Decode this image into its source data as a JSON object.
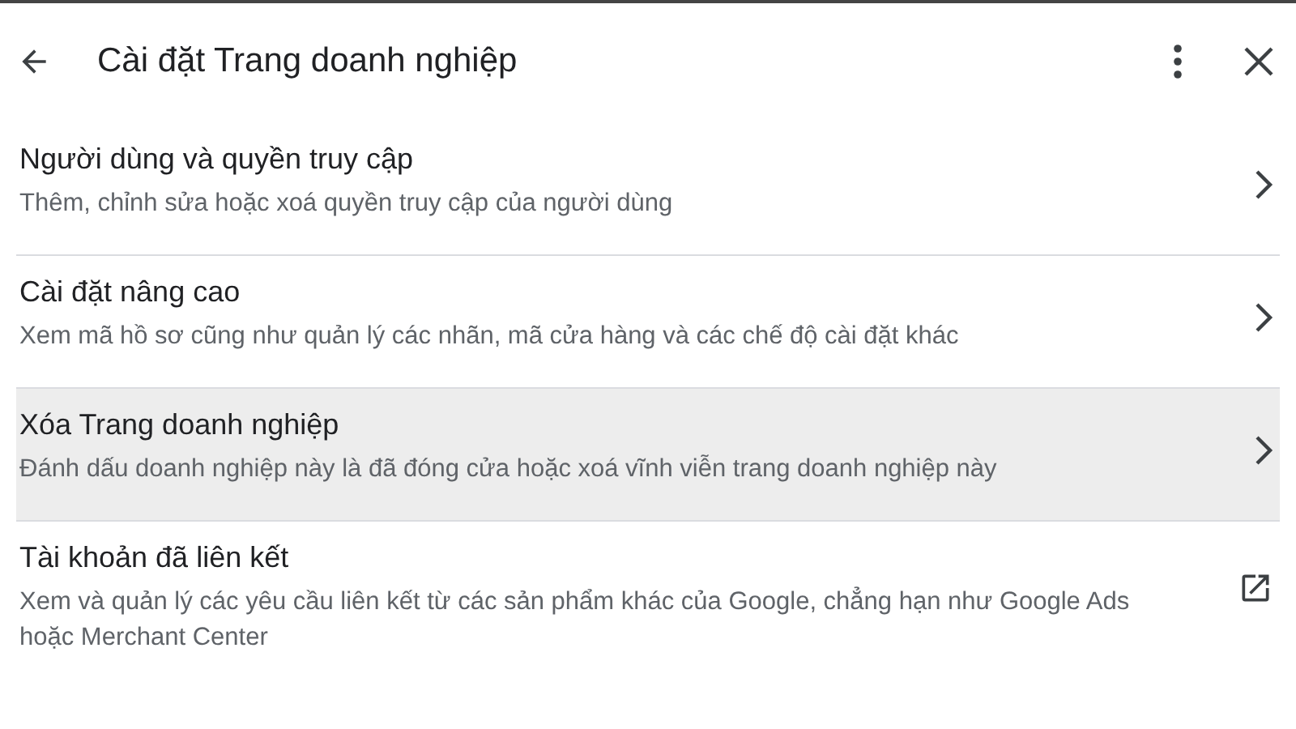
{
  "header": {
    "title": "Cài đặt Trang doanh nghiệp"
  },
  "items": [
    {
      "title": "Người dùng và quyền truy cập",
      "subtitle": "Thêm, chỉnh sửa hoặc xoá quyền truy cập của người dùng",
      "kind": "chevron",
      "selected": false
    },
    {
      "title": "Cài đặt nâng cao",
      "subtitle": "Xem mã hồ sơ cũng như quản lý các nhãn, mã cửa hàng và các chế độ cài đặt khác",
      "kind": "chevron",
      "selected": false
    },
    {
      "title": "Xóa Trang doanh nghiệp",
      "subtitle": "Đánh dấu doanh nghiệp này là đã đóng cửa hoặc xoá vĩnh viễn trang doanh nghiệp này",
      "kind": "chevron",
      "selected": true
    },
    {
      "title": "Tài khoản đã liên kết",
      "subtitle": "Xem và quản lý các yêu cầu liên kết từ các sản phẩm khác của Google, chẳng hạn như Google Ads hoặc Merchant Center",
      "kind": "external",
      "selected": false
    }
  ]
}
